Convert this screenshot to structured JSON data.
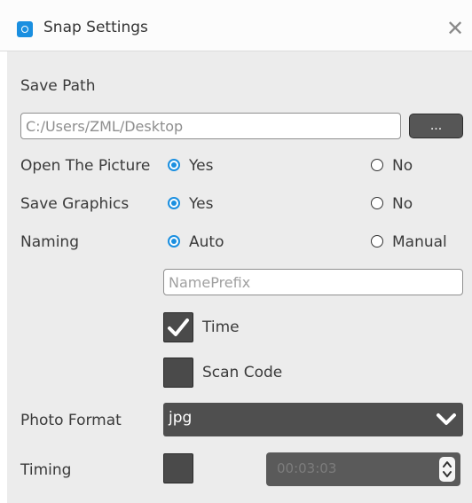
{
  "window": {
    "title": "Snap Settings",
    "close_glyph": "✕",
    "app_icon": "camera-icon"
  },
  "save_path": {
    "label": "Save Path",
    "value": "C:/Users/ZML/Desktop",
    "browse_label": "..."
  },
  "open_picture": {
    "label": "Open The Picture",
    "yes": "Yes",
    "no": "No",
    "selected": "yes"
  },
  "save_graphics": {
    "label": "Save Graphics",
    "yes": "Yes",
    "no": "No",
    "selected": "yes"
  },
  "naming": {
    "label": "Naming",
    "auto": "Auto",
    "manual": "Manual",
    "selected": "auto",
    "prefix_placeholder": "NamePrefix"
  },
  "options": {
    "time_label": "Time",
    "time_checked": true,
    "scan_code_label": "Scan Code",
    "scan_code_checked": false
  },
  "photo_format": {
    "label": "Photo Format",
    "value": "jpg"
  },
  "timing": {
    "label": "Timing",
    "checked": false,
    "value": "00:03:03"
  },
  "colors": {
    "accent": "#1a8fe0",
    "dark_control": "#4f4f4f",
    "panel_bg": "#ececec"
  }
}
